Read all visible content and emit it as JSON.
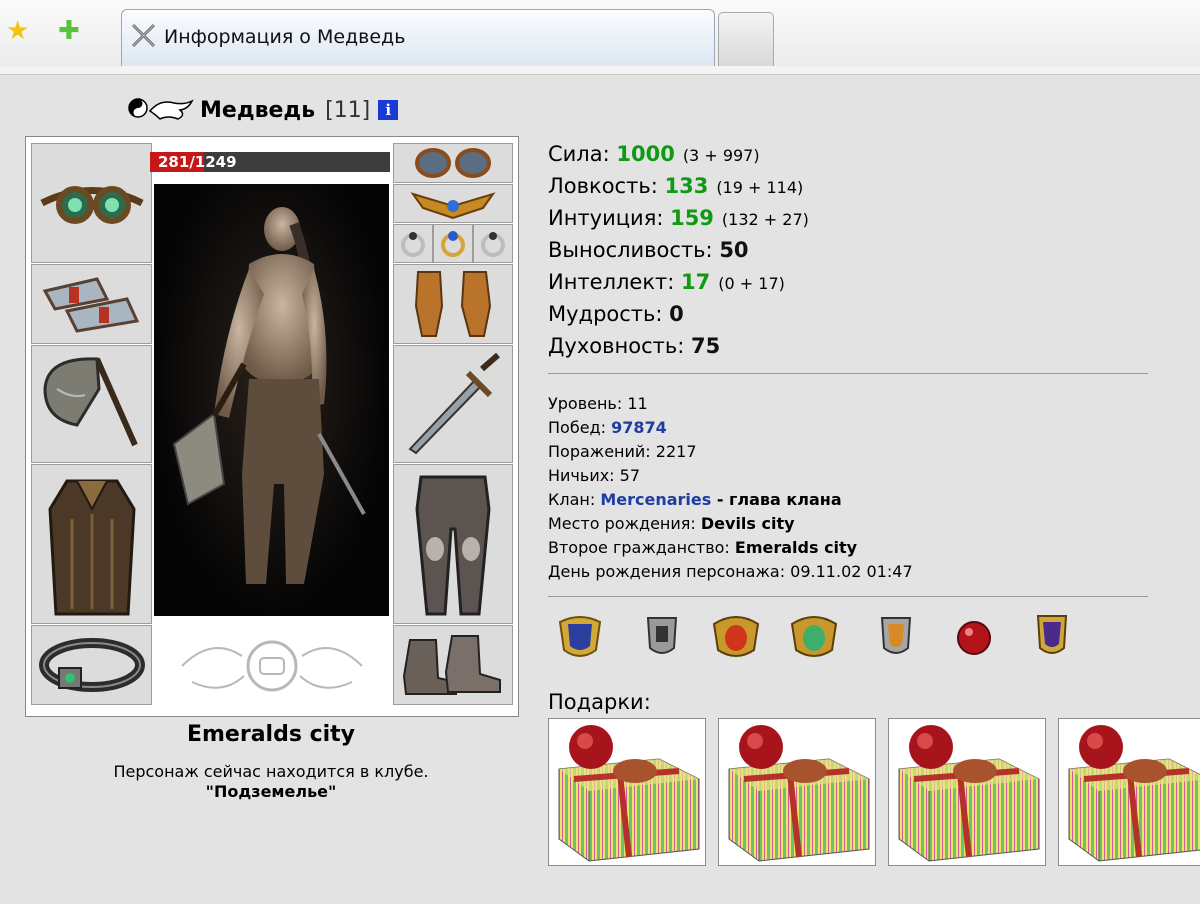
{
  "browser": {
    "tab_title": "Информация о Медведь"
  },
  "character": {
    "name": "Медведь",
    "level": "[11]",
    "info_icon": "i",
    "hp_current": "281",
    "hp_separator": "/",
    "hp_max": "1249",
    "hp_fraction": 0.225,
    "city": "Emeralds city",
    "location_line1": "Персонаж сейчас находится в клубе.",
    "location_line2": "\"Подземелье\""
  },
  "stats": [
    {
      "label": "Сила: ",
      "value": "1000",
      "breakdown": "(3 + 997)",
      "color": "green"
    },
    {
      "label": "Ловкость: ",
      "value": "133",
      "breakdown": "(19 + 114)",
      "color": "green"
    },
    {
      "label": "Интуиция: ",
      "value": "159",
      "breakdown": "(132 + 27)",
      "color": "green"
    },
    {
      "label": "Выносливость: ",
      "value": "50",
      "breakdown": "",
      "color": "black"
    },
    {
      "label": "Интеллект: ",
      "value": "17",
      "breakdown": "(0 + 17)",
      "color": "green"
    },
    {
      "label": "Мудрость: ",
      "value": "0",
      "breakdown": "",
      "color": "black"
    },
    {
      "label": "Духовность: ",
      "value": "75",
      "breakdown": "",
      "color": "black"
    }
  ],
  "info": {
    "level_label": "Уровень: ",
    "level_value": "11",
    "wins_label": "Побед: ",
    "wins_value": "97874",
    "losses_label": "Поражений: ",
    "losses_value": "2217",
    "draws_label": "Ничьих: ",
    "draws_value": "57",
    "clan_label": "Клан: ",
    "clan_name": "Mercenaries",
    "clan_role": " - глава клана",
    "birthplace_label": "Место рождения: ",
    "birthplace_value": "Devils city",
    "second_citizenship_label": "Второе гражданство: ",
    "second_citizenship_value": "Emeralds city",
    "birthday_label": "День рождения персонажа: ",
    "birthday_value": "09.11.02 01:47"
  },
  "badges": [
    "blue-shield-badge-icon",
    "knight-shield-badge-icon",
    "red-crest-badge-icon",
    "green-crest-badge-icon",
    "silver-shield-badge-icon",
    "red-orb-badge-icon",
    "purple-shield-badge-icon"
  ],
  "gifts_label": "Подарки:",
  "gifts_count": 4,
  "colors": {
    "stat_green": "#0f9a14",
    "link_blue": "#1d3e9e",
    "hp_red": "#c61717"
  }
}
